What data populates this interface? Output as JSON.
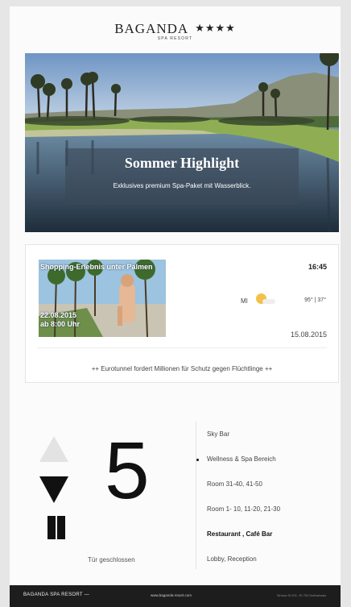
{
  "header": {
    "brand_name": "BAGANDA",
    "stars": "★★★★",
    "subtitle": "SPA RESORT"
  },
  "hero": {
    "title": "Sommer Highlight",
    "subtitle": "Exklusives premium Spa-Paket mit Wasserblick."
  },
  "info": {
    "promo_title": "Shopping-Erlebnis unter Palmen",
    "promo_date": "22.08.2015",
    "promo_time": "ab 8:00 Uhr",
    "time": "16:45",
    "weather_day": "MI",
    "weather_icon": "sun-cloud-icon",
    "temperature": "95° | 37°",
    "date": "15.08.2015",
    "ticker": "++ Eurotunnel fordert Millionen für Schutz gegen Flüchtlinge ++"
  },
  "elevator": {
    "current_floor": "5",
    "direction": "down",
    "door_status": "Tür geschlossen",
    "floors": [
      {
        "label": "Sky Bar",
        "bold": false,
        "current": false
      },
      {
        "label": "Wellness & Spa Bereich",
        "bold": false,
        "current": true
      },
      {
        "label": "Room 31-40, 41-50",
        "bold": false,
        "current": false
      },
      {
        "label": "Room 1- 10, 11-20, 21-30",
        "bold": false,
        "current": false
      },
      {
        "label": "Restaurant , Café Bar",
        "bold": true,
        "current": false
      },
      {
        "label": "Lobby, Reception",
        "bold": false,
        "current": false
      }
    ]
  },
  "footer": {
    "left": "BAGANDA SPA RESORT —",
    "mid": "www.baganda-resort.com",
    "right": "Sirtusa St 201, 90 763 Delbarbaka"
  }
}
